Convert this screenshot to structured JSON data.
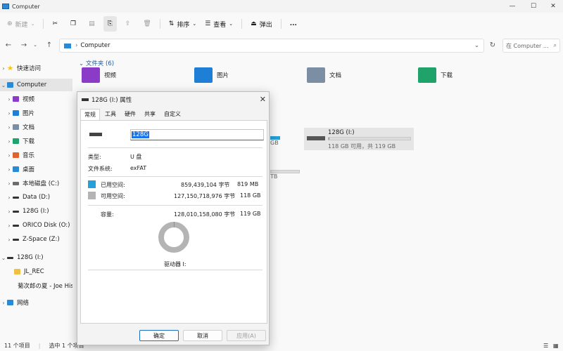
{
  "titlebar": {
    "title": "Computer"
  },
  "toolbar": {
    "new_label": "新建",
    "sort_label": "排序",
    "view_label": "查看",
    "eject_label": "弹出",
    "more_label": "..."
  },
  "address": {
    "path": "Computer",
    "search_placeholder": "在 Computer ..."
  },
  "sidebar": {
    "items": [
      {
        "label": "快速访问"
      },
      {
        "label": "Computer"
      },
      {
        "label": "视频"
      },
      {
        "label": "图片"
      },
      {
        "label": "文档"
      },
      {
        "label": "下载"
      },
      {
        "label": "音乐"
      },
      {
        "label": "桌面"
      },
      {
        "label": "本地磁盘 (C:)"
      },
      {
        "label": "Data (D:)"
      },
      {
        "label": "128G (I:)"
      },
      {
        "label": "ORICO Disk (O:)"
      },
      {
        "label": "Z-Space (Z:)"
      },
      {
        "label": "128G (I:)"
      },
      {
        "label": "JL_REC"
      },
      {
        "label": "菊次郎の夏 - Joe His"
      },
      {
        "label": "网络"
      }
    ]
  },
  "content": {
    "folders_header": "文件夹 (6)",
    "folders": [
      {
        "label": "视频"
      },
      {
        "label": "图片"
      },
      {
        "label": "文档"
      },
      {
        "label": "下载"
      }
    ],
    "drive_partial_gb": "GB",
    "drive_partial_tb": "TB",
    "selected_drive": {
      "name": "128G (I:)",
      "space": "118 GB 可用，共 119 GB",
      "used_fraction": 0.01
    }
  },
  "status": {
    "items": "11 个项目",
    "selected": "选中 1 个项目"
  },
  "dialog": {
    "title": "128G (I:) 属性",
    "tabs": [
      "常规",
      "工具",
      "硬件",
      "共享",
      "自定义"
    ],
    "name_value": "128G",
    "type_label": "类型:",
    "type_value": "U 盘",
    "fs_label": "文件系统:",
    "fs_value": "exFAT",
    "used_label": "已用空间:",
    "used_bytes": "859,439,104 字节",
    "used_size": "819 MB",
    "free_label": "可用空间:",
    "free_bytes": "127,150,718,976 字节",
    "free_size": "118 GB",
    "capacity_label": "容量:",
    "capacity_bytes": "128,010,158,080 字节",
    "capacity_size": "119 GB",
    "drive_label": "驱动器 I:",
    "used_fraction": 0.0067,
    "colors": {
      "used": "#26a0da",
      "free": "#b4b4b4"
    },
    "ok_label": "确定",
    "cancel_label": "取消",
    "apply_label": "应用(A)"
  }
}
